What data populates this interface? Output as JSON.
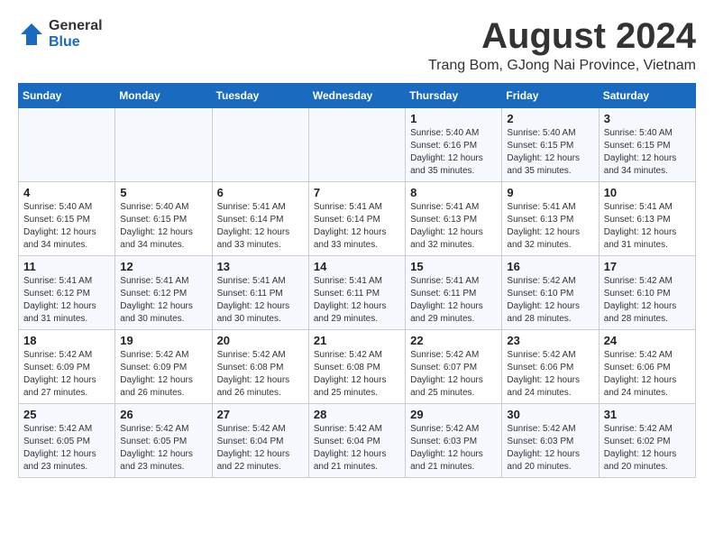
{
  "logo": {
    "general": "General",
    "blue": "Blue"
  },
  "title": {
    "month_year": "August 2024",
    "location": "Trang Bom, GJong Nai Province, Vietnam"
  },
  "headers": [
    "Sunday",
    "Monday",
    "Tuesday",
    "Wednesday",
    "Thursday",
    "Friday",
    "Saturday"
  ],
  "weeks": [
    [
      {
        "day": "",
        "info": ""
      },
      {
        "day": "",
        "info": ""
      },
      {
        "day": "",
        "info": ""
      },
      {
        "day": "",
        "info": ""
      },
      {
        "day": "1",
        "info": "Sunrise: 5:40 AM\nSunset: 6:16 PM\nDaylight: 12 hours\nand 35 minutes."
      },
      {
        "day": "2",
        "info": "Sunrise: 5:40 AM\nSunset: 6:15 PM\nDaylight: 12 hours\nand 35 minutes."
      },
      {
        "day": "3",
        "info": "Sunrise: 5:40 AM\nSunset: 6:15 PM\nDaylight: 12 hours\nand 34 minutes."
      }
    ],
    [
      {
        "day": "4",
        "info": "Sunrise: 5:40 AM\nSunset: 6:15 PM\nDaylight: 12 hours\nand 34 minutes."
      },
      {
        "day": "5",
        "info": "Sunrise: 5:40 AM\nSunset: 6:15 PM\nDaylight: 12 hours\nand 34 minutes."
      },
      {
        "day": "6",
        "info": "Sunrise: 5:41 AM\nSunset: 6:14 PM\nDaylight: 12 hours\nand 33 minutes."
      },
      {
        "day": "7",
        "info": "Sunrise: 5:41 AM\nSunset: 6:14 PM\nDaylight: 12 hours\nand 33 minutes."
      },
      {
        "day": "8",
        "info": "Sunrise: 5:41 AM\nSunset: 6:13 PM\nDaylight: 12 hours\nand 32 minutes."
      },
      {
        "day": "9",
        "info": "Sunrise: 5:41 AM\nSunset: 6:13 PM\nDaylight: 12 hours\nand 32 minutes."
      },
      {
        "day": "10",
        "info": "Sunrise: 5:41 AM\nSunset: 6:13 PM\nDaylight: 12 hours\nand 31 minutes."
      }
    ],
    [
      {
        "day": "11",
        "info": "Sunrise: 5:41 AM\nSunset: 6:12 PM\nDaylight: 12 hours\nand 31 minutes."
      },
      {
        "day": "12",
        "info": "Sunrise: 5:41 AM\nSunset: 6:12 PM\nDaylight: 12 hours\nand 30 minutes."
      },
      {
        "day": "13",
        "info": "Sunrise: 5:41 AM\nSunset: 6:11 PM\nDaylight: 12 hours\nand 30 minutes."
      },
      {
        "day": "14",
        "info": "Sunrise: 5:41 AM\nSunset: 6:11 PM\nDaylight: 12 hours\nand 29 minutes."
      },
      {
        "day": "15",
        "info": "Sunrise: 5:41 AM\nSunset: 6:11 PM\nDaylight: 12 hours\nand 29 minutes."
      },
      {
        "day": "16",
        "info": "Sunrise: 5:42 AM\nSunset: 6:10 PM\nDaylight: 12 hours\nand 28 minutes."
      },
      {
        "day": "17",
        "info": "Sunrise: 5:42 AM\nSunset: 6:10 PM\nDaylight: 12 hours\nand 28 minutes."
      }
    ],
    [
      {
        "day": "18",
        "info": "Sunrise: 5:42 AM\nSunset: 6:09 PM\nDaylight: 12 hours\nand 27 minutes."
      },
      {
        "day": "19",
        "info": "Sunrise: 5:42 AM\nSunset: 6:09 PM\nDaylight: 12 hours\nand 26 minutes."
      },
      {
        "day": "20",
        "info": "Sunrise: 5:42 AM\nSunset: 6:08 PM\nDaylight: 12 hours\nand 26 minutes."
      },
      {
        "day": "21",
        "info": "Sunrise: 5:42 AM\nSunset: 6:08 PM\nDaylight: 12 hours\nand 25 minutes."
      },
      {
        "day": "22",
        "info": "Sunrise: 5:42 AM\nSunset: 6:07 PM\nDaylight: 12 hours\nand 25 minutes."
      },
      {
        "day": "23",
        "info": "Sunrise: 5:42 AM\nSunset: 6:06 PM\nDaylight: 12 hours\nand 24 minutes."
      },
      {
        "day": "24",
        "info": "Sunrise: 5:42 AM\nSunset: 6:06 PM\nDaylight: 12 hours\nand 24 minutes."
      }
    ],
    [
      {
        "day": "25",
        "info": "Sunrise: 5:42 AM\nSunset: 6:05 PM\nDaylight: 12 hours\nand 23 minutes."
      },
      {
        "day": "26",
        "info": "Sunrise: 5:42 AM\nSunset: 6:05 PM\nDaylight: 12 hours\nand 23 minutes."
      },
      {
        "day": "27",
        "info": "Sunrise: 5:42 AM\nSunset: 6:04 PM\nDaylight: 12 hours\nand 22 minutes."
      },
      {
        "day": "28",
        "info": "Sunrise: 5:42 AM\nSunset: 6:04 PM\nDaylight: 12 hours\nand 21 minutes."
      },
      {
        "day": "29",
        "info": "Sunrise: 5:42 AM\nSunset: 6:03 PM\nDaylight: 12 hours\nand 21 minutes."
      },
      {
        "day": "30",
        "info": "Sunrise: 5:42 AM\nSunset: 6:03 PM\nDaylight: 12 hours\nand 20 minutes."
      },
      {
        "day": "31",
        "info": "Sunrise: 5:42 AM\nSunset: 6:02 PM\nDaylight: 12 hours\nand 20 minutes."
      }
    ]
  ]
}
